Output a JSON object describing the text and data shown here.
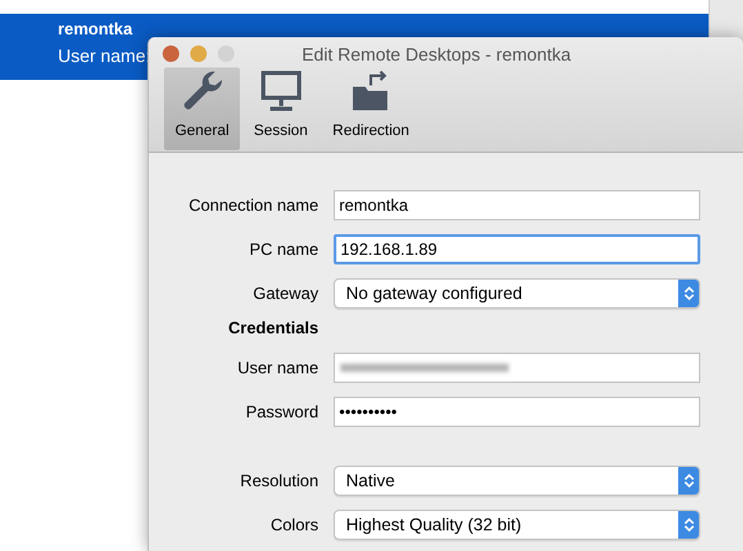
{
  "background_list": {
    "item": {
      "title": "remontka",
      "subtitle": "User name:",
      "selected": true
    }
  },
  "dialog": {
    "title": "Edit Remote Desktops - remontka",
    "tabs": [
      {
        "label": "General",
        "kind": "wrench",
        "selected": true
      },
      {
        "label": "Session",
        "kind": "monitor",
        "selected": false
      },
      {
        "label": "Redirection",
        "kind": "folder",
        "selected": false
      }
    ],
    "fields": [
      {
        "kind": "text",
        "label": "Connection name",
        "value": "remontka",
        "focused": false
      },
      {
        "kind": "text",
        "label": "PC name",
        "value": "192.168.1.89",
        "focused": true
      },
      {
        "kind": "select",
        "label": "Gateway",
        "value": "No gateway configured"
      },
      {
        "kind": "heading",
        "label": "Credentials"
      },
      {
        "kind": "redacted",
        "label": "User name"
      },
      {
        "kind": "text",
        "label": "Password",
        "value": "••••••••••",
        "focused": false
      },
      {
        "kind": "spacer"
      },
      {
        "kind": "select",
        "label": "Resolution",
        "value": "Native"
      },
      {
        "kind": "select",
        "label": "Colors",
        "value": "Highest Quality (32 bit)"
      }
    ]
  }
}
